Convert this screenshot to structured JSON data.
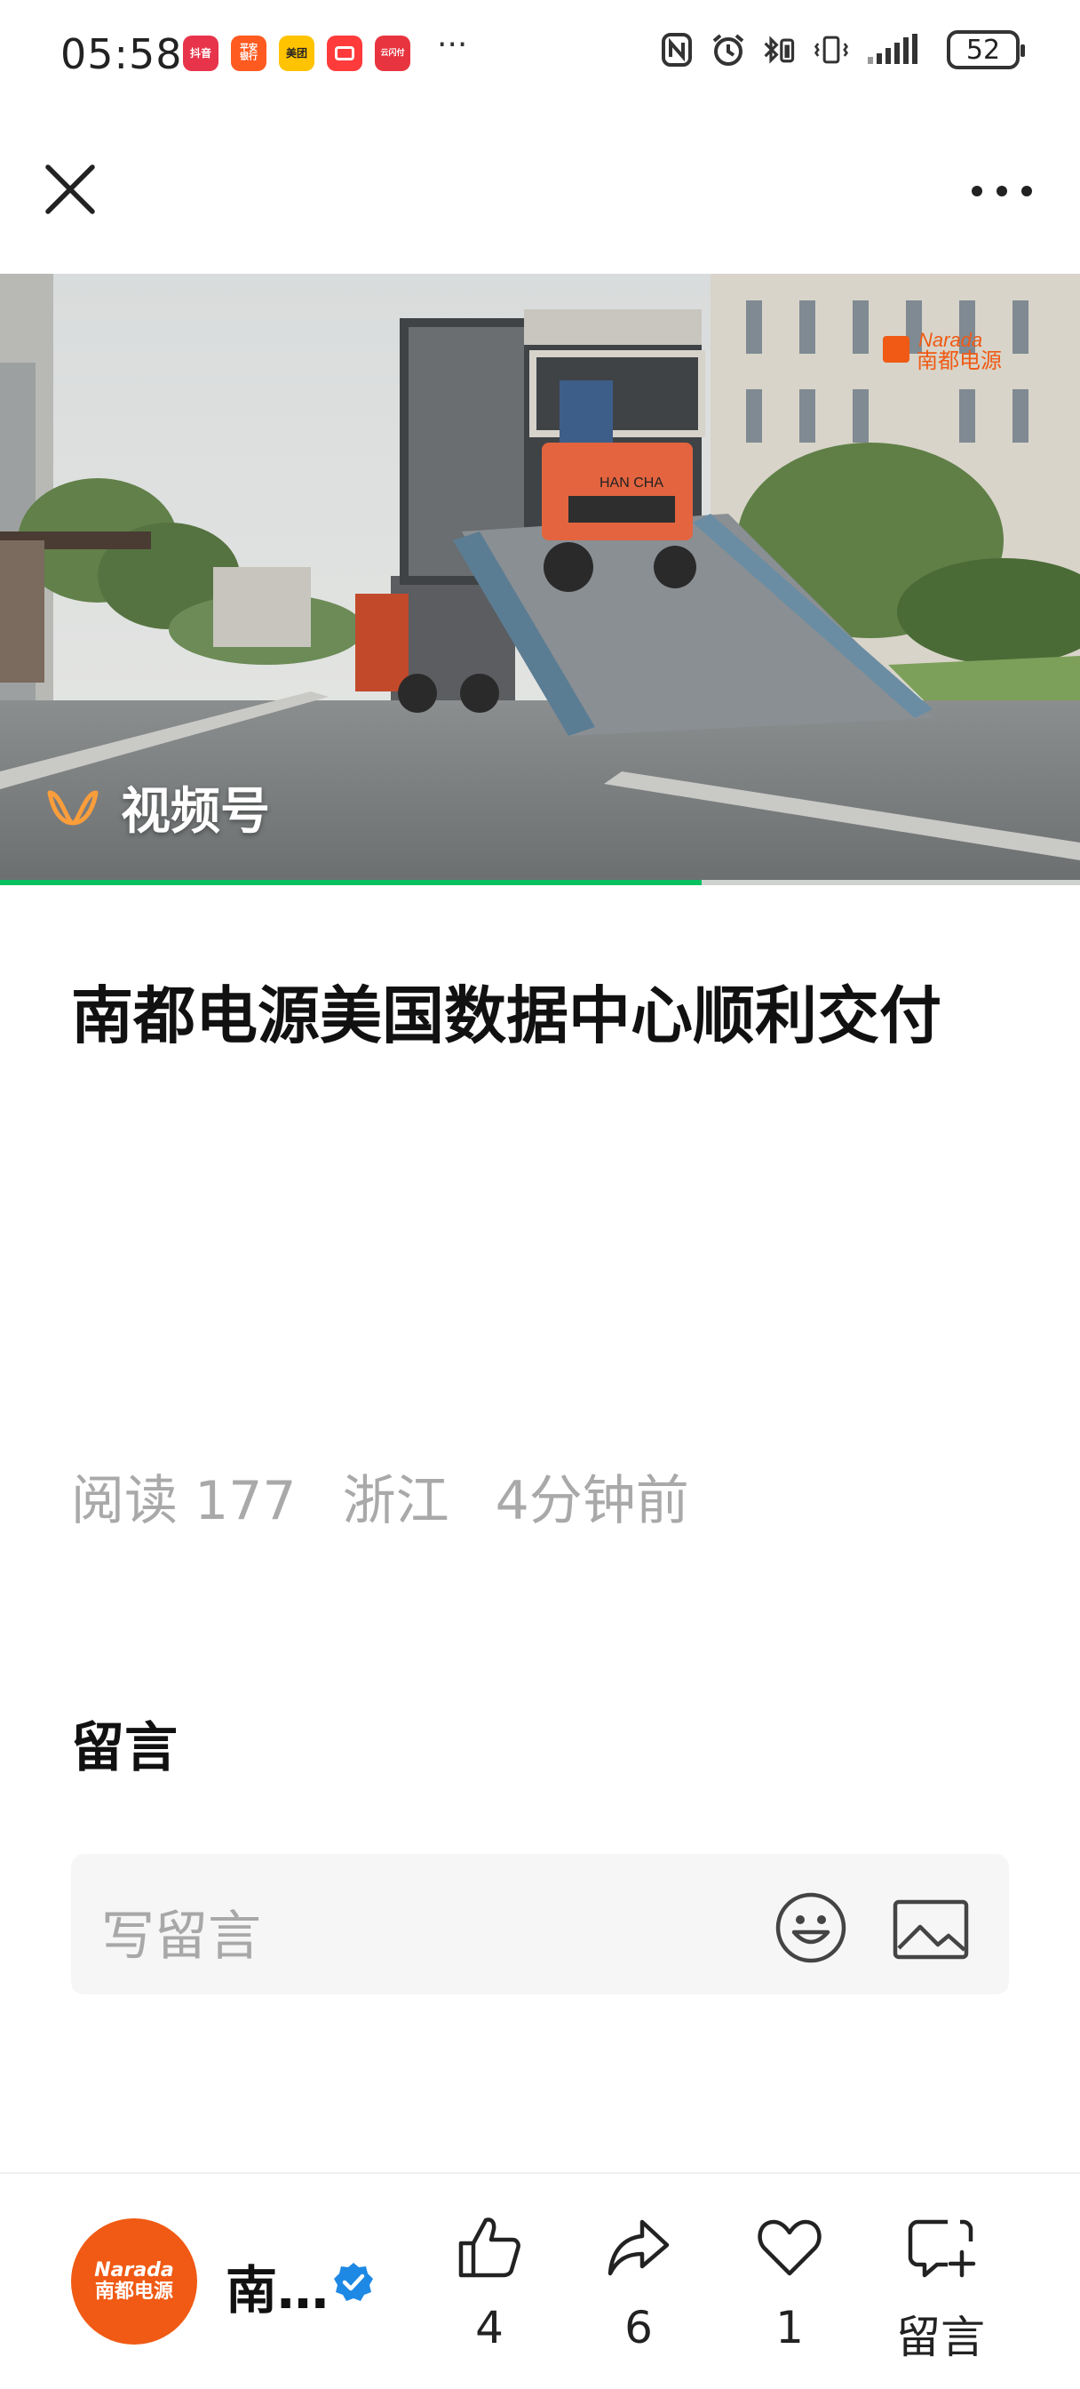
{
  "status_bar": {
    "time": "05:58",
    "more_notifications": "···",
    "battery": "52",
    "app_icons": [
      {
        "label": "抖音",
        "color": "#e8344a"
      },
      {
        "label": "平安\n银行",
        "color": "#ff5a1f"
      },
      {
        "label": "美团",
        "color": "#ffc300"
      },
      {
        "label": "",
        "color": "#ff3b3b"
      },
      {
        "label": "云闪付",
        "color": "#e8343f"
      }
    ]
  },
  "video": {
    "channel_label": "视频号",
    "watermark_en": "Narada",
    "watermark_cn": "南都电源",
    "forklift_text": "HAN CHA",
    "progress_fraction": 0.65
  },
  "article": {
    "title": "南都电源美国数据中心顺利交付",
    "reads": "阅读 177",
    "location": "浙江",
    "time_ago": "4分钟前"
  },
  "comments": {
    "heading": "留言",
    "placeholder": "写留言"
  },
  "bottom_bar": {
    "account_name": "南…",
    "avatar_en": "Narada",
    "avatar_cn": "南都电源",
    "like_count": "4",
    "share_count": "6",
    "favorite_count": "1",
    "comment_label": "留言"
  },
  "colors": {
    "brand": "#f05a14",
    "progress": "#07c160",
    "verified": "#1e88e5",
    "muted_text": "#a9a9a9"
  }
}
